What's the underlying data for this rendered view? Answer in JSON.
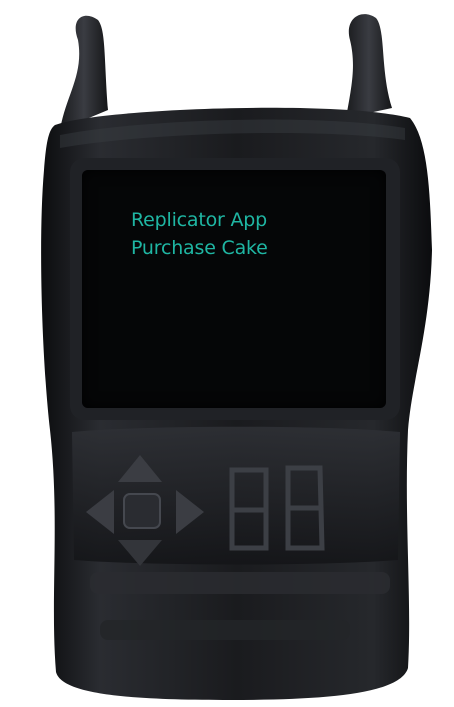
{
  "screen": {
    "line1": "Replicator App",
    "line2": "Purchase Cake",
    "text_color": "#1fb6a3",
    "background": "#050607"
  },
  "device": {
    "body_color": "#17181b",
    "icons": [
      "left-arrow-icon",
      "up-arrow-icon",
      "right-arrow-icon",
      "down-arrow-icon",
      "center-button-icon"
    ]
  }
}
